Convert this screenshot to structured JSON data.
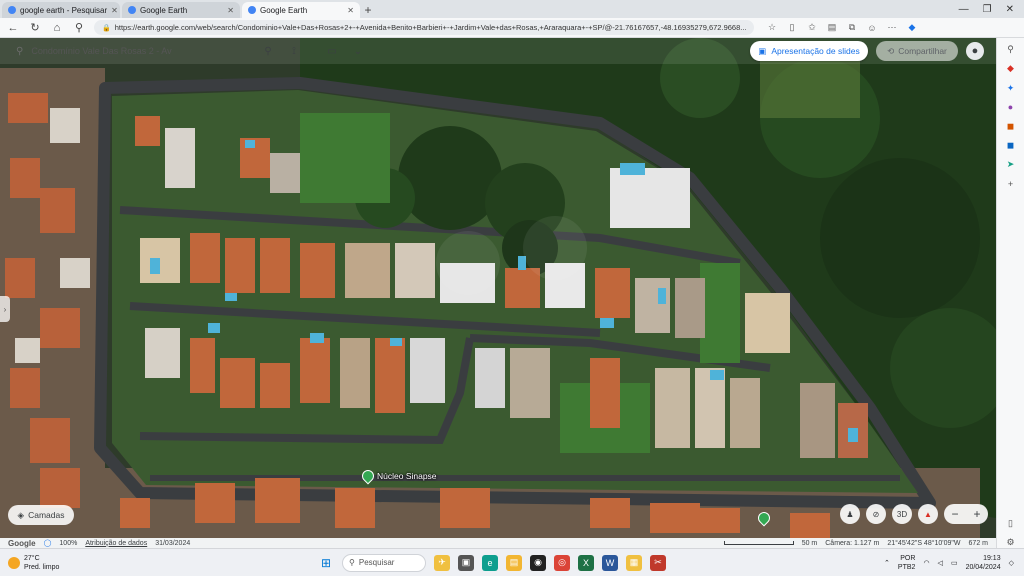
{
  "browser": {
    "tabs": [
      {
        "label": "google earth - Pesquisar",
        "active": false,
        "color": "#4285f4"
      },
      {
        "label": "Google Earth",
        "active": false,
        "color": "#4285f4"
      },
      {
        "label": "Google Earth",
        "active": true,
        "color": "#4285f4"
      }
    ],
    "new_tab_label": "+",
    "url": "https://earth.google.com/web/search/Condominio+Vale+Das+Rosas+2+-+Avenida+Benito+Barbieri+-+Jardim+Vale+das+Rosas,+Araraquara+-+SP/@-21.76167657,-48.16935279,672.9668..."
  },
  "earth": {
    "search_text": "Condomínio Vale Das Rosas 2 - Av",
    "slides_label": "Apresentação de slides",
    "share_label": "Compartilhar",
    "layers_label": "Camadas",
    "poi_label": "Núcleo Sinapse",
    "ctrl_3d": "3D",
    "zoom_out": "−",
    "zoom_in": "+"
  },
  "status": {
    "google": "Google",
    "zoom": "100%",
    "attribution": "Atribuição de dados",
    "date": "31/03/2024",
    "scale": "50 m",
    "camera": "Câmera: 1.127 m",
    "coords": "21°45'42\"S 48°10'09\"W",
    "altitude": "672 m"
  },
  "taskbar": {
    "temp": "27°C",
    "weather": "Pred. limpo",
    "search_placeholder": "Pesquisar",
    "lang": "POR",
    "layout": "PTB2",
    "time": "19:13",
    "date": "20/04/2024"
  },
  "colors": {
    "accent": "#1a73e8",
    "forest": "#1f3a1a",
    "road": "#3a3d40",
    "grass": "#2f6a2a",
    "roof": "#c1673b"
  }
}
